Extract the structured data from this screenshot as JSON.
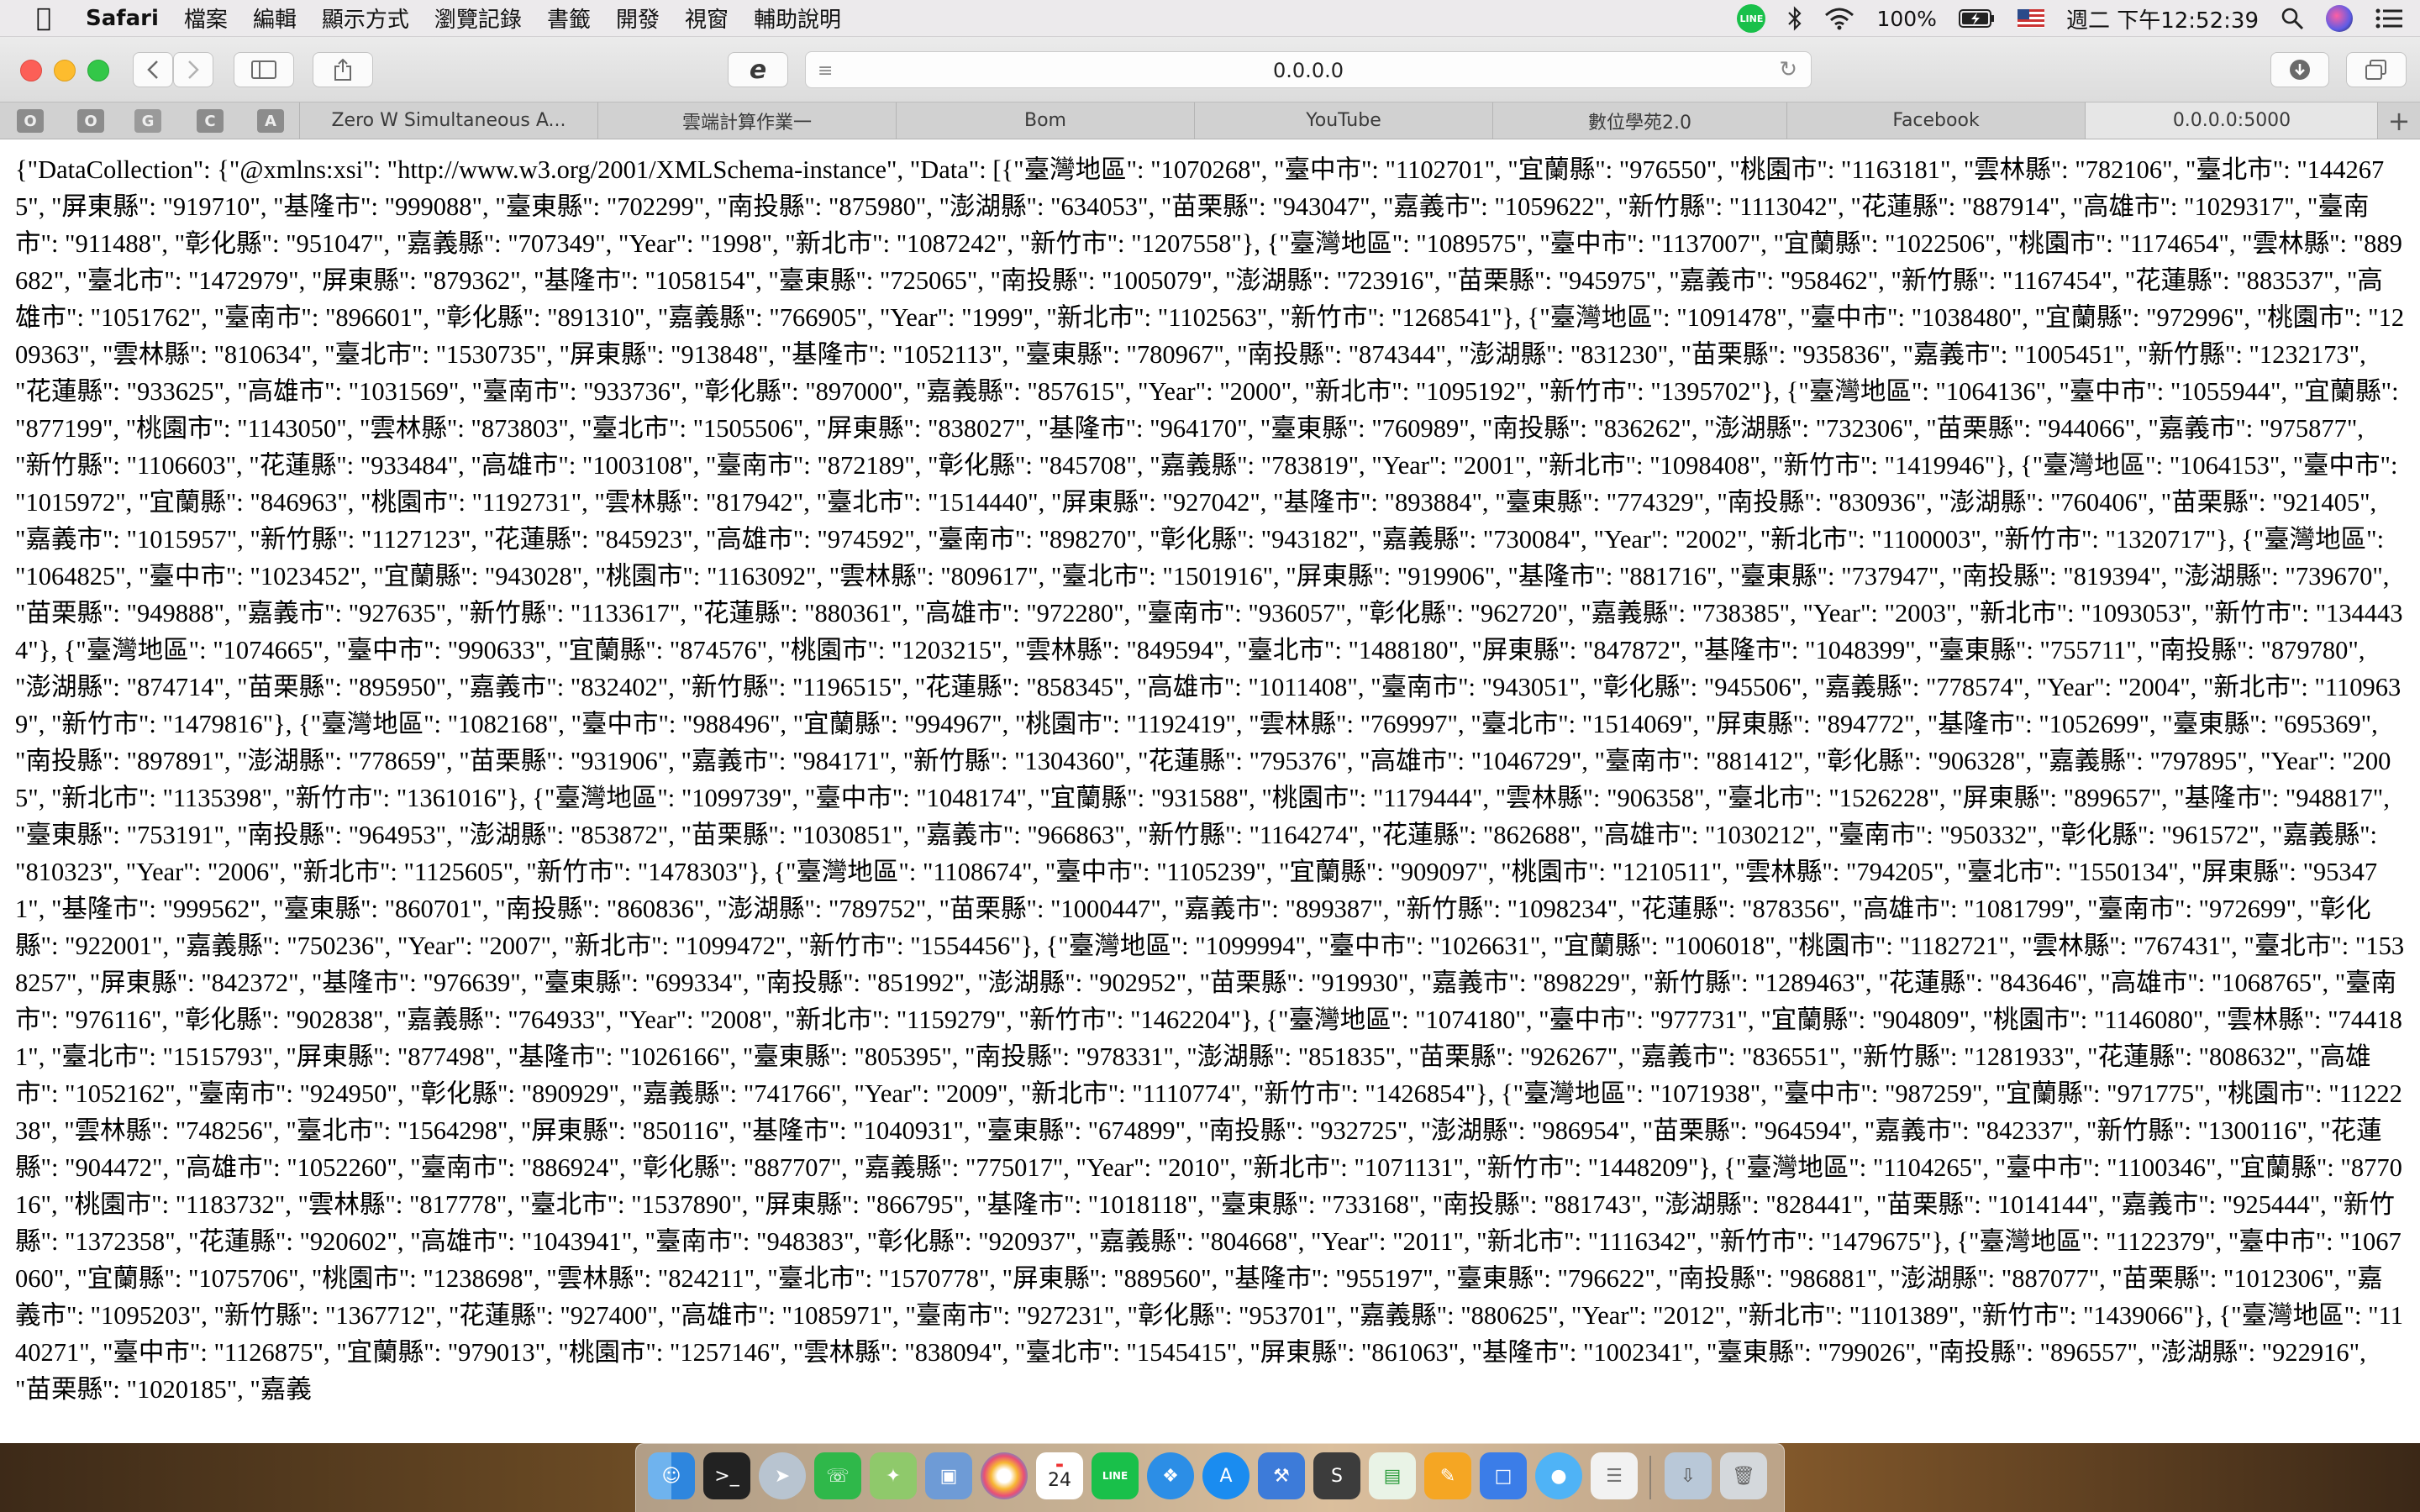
{
  "menubar": {
    "app_name": "Safari",
    "items": [
      "檔案",
      "編輯",
      "顯示方式",
      "瀏覽記錄",
      "書籤",
      "開發",
      "視窗",
      "輔助說明"
    ],
    "line_badge": "LINE",
    "battery": "100%",
    "clock": "週二 下午12:52:39"
  },
  "toolbar": {
    "url": "0.0.0.0"
  },
  "pinned_tabs": [
    "O",
    "O",
    "G",
    "C",
    "A"
  ],
  "tabs": [
    {
      "label": "Zero W Simultaneous A..."
    },
    {
      "label": "雲端計算作業一"
    },
    {
      "label": "Bom"
    },
    {
      "label": "YouTube"
    },
    {
      "label": "數位學苑2.0"
    },
    {
      "label": "Facebook"
    },
    {
      "label": "0.0.0.0:5000"
    }
  ],
  "content": {
    "raw_json": "{\"DataCollection\": {\"@xmlns:xsi\": \"http://www.w3.org/2001/XMLSchema-instance\", \"Data\": [{\"臺灣地區\": \"1070268\", \"臺中市\": \"1102701\", \"宜蘭縣\": \"976550\", \"桃園市\": \"1163181\", \"雲林縣\": \"782106\", \"臺北市\": \"1442675\", \"屏東縣\": \"919710\", \"基隆市\": \"999088\", \"臺東縣\": \"702299\", \"南投縣\": \"875980\", \"澎湖縣\": \"634053\", \"苗栗縣\": \"943047\", \"嘉義市\": \"1059622\", \"新竹縣\": \"1113042\", \"花蓮縣\": \"887914\", \"高雄市\": \"1029317\", \"臺南市\": \"911488\", \"彰化縣\": \"951047\", \"嘉義縣\": \"707349\", \"Year\": \"1998\", \"新北市\": \"1087242\", \"新竹市\": \"1207558\"}, {\"臺灣地區\": \"1089575\", \"臺中市\": \"1137007\", \"宜蘭縣\": \"1022506\", \"桃園市\": \"1174654\", \"雲林縣\": \"889682\", \"臺北市\": \"1472979\", \"屏東縣\": \"879362\", \"基隆市\": \"1058154\", \"臺東縣\": \"725065\", \"南投縣\": \"1005079\", \"澎湖縣\": \"723916\", \"苗栗縣\": \"945975\", \"嘉義市\": \"958462\", \"新竹縣\": \"1167454\", \"花蓮縣\": \"883537\", \"高雄市\": \"1051762\", \"臺南市\": \"896601\", \"彰化縣\": \"891310\", \"嘉義縣\": \"766905\", \"Year\": \"1999\", \"新北市\": \"1102563\", \"新竹市\": \"1268541\"}, {\"臺灣地區\": \"1091478\", \"臺中市\": \"1038480\", \"宜蘭縣\": \"972996\", \"桃園市\": \"1209363\", \"雲林縣\": \"810634\", \"臺北市\": \"1530735\", \"屏東縣\": \"913848\", \"基隆市\": \"1052113\", \"臺東縣\": \"780967\", \"南投縣\": \"874344\", \"澎湖縣\": \"831230\", \"苗栗縣\": \"935836\", \"嘉義市\": \"1005451\", \"新竹縣\": \"1232173\", \"花蓮縣\": \"933625\", \"高雄市\": \"1031569\", \"臺南市\": \"933736\", \"彰化縣\": \"897000\", \"嘉義縣\": \"857615\", \"Year\": \"2000\", \"新北市\": \"1095192\", \"新竹市\": \"1395702\"}, {\"臺灣地區\": \"1064136\", \"臺中市\": \"1055944\", \"宜蘭縣\": \"877199\", \"桃園市\": \"1143050\", \"雲林縣\": \"873803\", \"臺北市\": \"1505506\", \"屏東縣\": \"838027\", \"基隆市\": \"964170\", \"臺東縣\": \"760989\", \"南投縣\": \"836262\", \"澎湖縣\": \"732306\", \"苗栗縣\": \"944066\", \"嘉義市\": \"975877\", \"新竹縣\": \"1106603\", \"花蓮縣\": \"933484\", \"高雄市\": \"1003108\", \"臺南市\": \"872189\", \"彰化縣\": \"845708\", \"嘉義縣\": \"783819\", \"Year\": \"2001\", \"新北市\": \"1098408\", \"新竹市\": \"1419946\"}, {\"臺灣地區\": \"1064153\", \"臺中市\": \"1015972\", \"宜蘭縣\": \"846963\", \"桃園市\": \"1192731\", \"雲林縣\": \"817942\", \"臺北市\": \"1514440\", \"屏東縣\": \"927042\", \"基隆市\": \"893884\", \"臺東縣\": \"774329\", \"南投縣\": \"830936\", \"澎湖縣\": \"760406\", \"苗栗縣\": \"921405\", \"嘉義市\": \"1015957\", \"新竹縣\": \"1127123\", \"花蓮縣\": \"845923\", \"高雄市\": \"974592\", \"臺南市\": \"898270\", \"彰化縣\": \"943182\", \"嘉義縣\": \"730084\", \"Year\": \"2002\", \"新北市\": \"1100003\", \"新竹市\": \"1320717\"}, {\"臺灣地區\": \"1064825\", \"臺中市\": \"1023452\", \"宜蘭縣\": \"943028\", \"桃園市\": \"1163092\", \"雲林縣\": \"809617\", \"臺北市\": \"1501916\", \"屏東縣\": \"919906\", \"基隆市\": \"881716\", \"臺東縣\": \"737947\", \"南投縣\": \"819394\", \"澎湖縣\": \"739670\", \"苗栗縣\": \"949888\", \"嘉義市\": \"927635\", \"新竹縣\": \"1133617\", \"花蓮縣\": \"880361\", \"高雄市\": \"972280\", \"臺南市\": \"936057\", \"彰化縣\": \"962720\", \"嘉義縣\": \"738385\", \"Year\": \"2003\", \"新北市\": \"1093053\", \"新竹市\": \"1344434\"}, {\"臺灣地區\": \"1074665\", \"臺中市\": \"990633\", \"宜蘭縣\": \"874576\", \"桃園市\": \"1203215\", \"雲林縣\": \"849594\", \"臺北市\": \"1488180\", \"屏東縣\": \"847872\", \"基隆市\": \"1048399\", \"臺東縣\": \"755711\", \"南投縣\": \"879780\", \"澎湖縣\": \"874714\", \"苗栗縣\": \"895950\", \"嘉義市\": \"832402\", \"新竹縣\": \"1196515\", \"花蓮縣\": \"858345\", \"高雄市\": \"1011408\", \"臺南市\": \"943051\", \"彰化縣\": \"945506\", \"嘉義縣\": \"778574\", \"Year\": \"2004\", \"新北市\": \"1109639\", \"新竹市\": \"1479816\"}, {\"臺灣地區\": \"1082168\", \"臺中市\": \"988496\", \"宜蘭縣\": \"994967\", \"桃園市\": \"1192419\", \"雲林縣\": \"769997\", \"臺北市\": \"1514069\", \"屏東縣\": \"894772\", \"基隆市\": \"1052699\", \"臺東縣\": \"695369\", \"南投縣\": \"897891\", \"澎湖縣\": \"778659\", \"苗栗縣\": \"931906\", \"嘉義市\": \"984171\", \"新竹縣\": \"1304360\", \"花蓮縣\": \"795376\", \"高雄市\": \"1046729\", \"臺南市\": \"881412\", \"彰化縣\": \"906328\", \"嘉義縣\": \"797895\", \"Year\": \"2005\", \"新北市\": \"1135398\", \"新竹市\": \"1361016\"}, {\"臺灣地區\": \"1099739\", \"臺中市\": \"1048174\", \"宜蘭縣\": \"931588\", \"桃園市\": \"1179444\", \"雲林縣\": \"906358\", \"臺北市\": \"1526228\", \"屏東縣\": \"899657\", \"基隆市\": \"948817\", \"臺東縣\": \"753191\", \"南投縣\": \"964953\", \"澎湖縣\": \"853872\", \"苗栗縣\": \"1030851\", \"嘉義市\": \"966863\", \"新竹縣\": \"1164274\", \"花蓮縣\": \"862688\", \"高雄市\": \"1030212\", \"臺南市\": \"950332\", \"彰化縣\": \"961572\", \"嘉義縣\": \"810323\", \"Year\": \"2006\", \"新北市\": \"1125605\", \"新竹市\": \"1478303\"}, {\"臺灣地區\": \"1108674\", \"臺中市\": \"1105239\", \"宜蘭縣\": \"909097\", \"桃園市\": \"1210511\", \"雲林縣\": \"794205\", \"臺北市\": \"1550134\", \"屏東縣\": \"953471\", \"基隆市\": \"999562\", \"臺東縣\": \"860701\", \"南投縣\": \"860836\", \"澎湖縣\": \"789752\", \"苗栗縣\": \"1000447\", \"嘉義市\": \"899387\", \"新竹縣\": \"1098234\", \"花蓮縣\": \"878356\", \"高雄市\": \"1081799\", \"臺南市\": \"972699\", \"彰化縣\": \"922001\", \"嘉義縣\": \"750236\", \"Year\": \"2007\", \"新北市\": \"1099472\", \"新竹市\": \"1554456\"}, {\"臺灣地區\": \"1099994\", \"臺中市\": \"1026631\", \"宜蘭縣\": \"1006018\", \"桃園市\": \"1182721\", \"雲林縣\": \"767431\", \"臺北市\": \"1538257\", \"屏東縣\": \"842372\", \"基隆市\": \"976639\", \"臺東縣\": \"699334\", \"南投縣\": \"851992\", \"澎湖縣\": \"902952\", \"苗栗縣\": \"919930\", \"嘉義市\": \"898229\", \"新竹縣\": \"1289463\", \"花蓮縣\": \"843646\", \"高雄市\": \"1068765\", \"臺南市\": \"976116\", \"彰化縣\": \"902838\", \"嘉義縣\": \"764933\", \"Year\": \"2008\", \"新北市\": \"1159279\", \"新竹市\": \"1462204\"}, {\"臺灣地區\": \"1074180\", \"臺中市\": \"977731\", \"宜蘭縣\": \"904809\", \"桃園市\": \"1146080\", \"雲林縣\": \"744181\", \"臺北市\": \"1515793\", \"屏東縣\": \"877498\", \"基隆市\": \"1026166\", \"臺東縣\": \"805395\", \"南投縣\": \"978331\", \"澎湖縣\": \"851835\", \"苗栗縣\": \"926267\", \"嘉義市\": \"836551\", \"新竹縣\": \"1281933\", \"花蓮縣\": \"808632\", \"高雄市\": \"1052162\", \"臺南市\": \"924950\", \"彰化縣\": \"890929\", \"嘉義縣\": \"741766\", \"Year\": \"2009\", \"新北市\": \"1110774\", \"新竹市\": \"1426854\"}, {\"臺灣地區\": \"1071938\", \"臺中市\": \"987259\", \"宜蘭縣\": \"971775\", \"桃園市\": \"1122238\", \"雲林縣\": \"748256\", \"臺北市\": \"1564298\", \"屏東縣\": \"850116\", \"基隆市\": \"1040931\", \"臺東縣\": \"674899\", \"南投縣\": \"932725\", \"澎湖縣\": \"986954\", \"苗栗縣\": \"964594\", \"嘉義市\": \"842337\", \"新竹縣\": \"1300116\", \"花蓮縣\": \"904472\", \"高雄市\": \"1052260\", \"臺南市\": \"886924\", \"彰化縣\": \"887707\", \"嘉義縣\": \"775017\", \"Year\": \"2010\", \"新北市\": \"1071131\", \"新竹市\": \"1448209\"}, {\"臺灣地區\": \"1104265\", \"臺中市\": \"1100346\", \"宜蘭縣\": \"877016\", \"桃園市\": \"1183732\", \"雲林縣\": \"817778\", \"臺北市\": \"1537890\", \"屏東縣\": \"866795\", \"基隆市\": \"1018118\", \"臺東縣\": \"733168\", \"南投縣\": \"881743\", \"澎湖縣\": \"828441\", \"苗栗縣\": \"1014144\", \"嘉義市\": \"925444\", \"新竹縣\": \"1372358\", \"花蓮縣\": \"920602\", \"高雄市\": \"1043941\", \"臺南市\": \"948383\", \"彰化縣\": \"920937\", \"嘉義縣\": \"804668\", \"Year\": \"2011\", \"新北市\": \"1116342\", \"新竹市\": \"1479675\"}, {\"臺灣地區\": \"1122379\", \"臺中市\": \"1067060\", \"宜蘭縣\": \"1075706\", \"桃園市\": \"1238698\", \"雲林縣\": \"824211\", \"臺北市\": \"1570778\", \"屏東縣\": \"889560\", \"基隆市\": \"955197\", \"臺東縣\": \"796622\", \"南投縣\": \"986881\", \"澎湖縣\": \"887077\", \"苗栗縣\": \"1012306\", \"嘉義市\": \"1095203\", \"新竹縣\": \"1367712\", \"花蓮縣\": \"927400\", \"高雄市\": \"1085971\", \"臺南市\": \"927231\", \"彰化縣\": \"953701\", \"嘉義縣\": \"880625\", \"Year\": \"2012\", \"新北市\": \"1101389\", \"新竹市\": \"1439066\"}, {\"臺灣地區\": \"1140271\", \"臺中市\": \"1126875\", \"宜蘭縣\": \"979013\", \"桃園市\": \"1257146\", \"雲林縣\": \"838094\", \"臺北市\": \"1545415\", \"屏東縣\": \"861063\", \"基隆市\": \"1002341\", \"臺東縣\": \"799026\", \"南投縣\": \"896557\", \"澎湖縣\": \"922916\", \"苗栗縣\": \"1020185\", \"嘉義"
  },
  "dock": {
    "calendar_day": "24",
    "items": [
      "finder-icon",
      "terminal-icon",
      "launchpad-icon",
      "facetime-icon",
      "maps-icon",
      "preview-icon",
      "photos-icon",
      "calendar-icon",
      "line-icon",
      "safari-icon",
      "app-store-icon",
      "xcode-icon",
      "sublime-icon",
      "numbers-icon",
      "pages-icon",
      "keynote-icon",
      "messages-icon",
      "textedit-icon",
      "downloads-icon",
      "trash-icon"
    ]
  }
}
